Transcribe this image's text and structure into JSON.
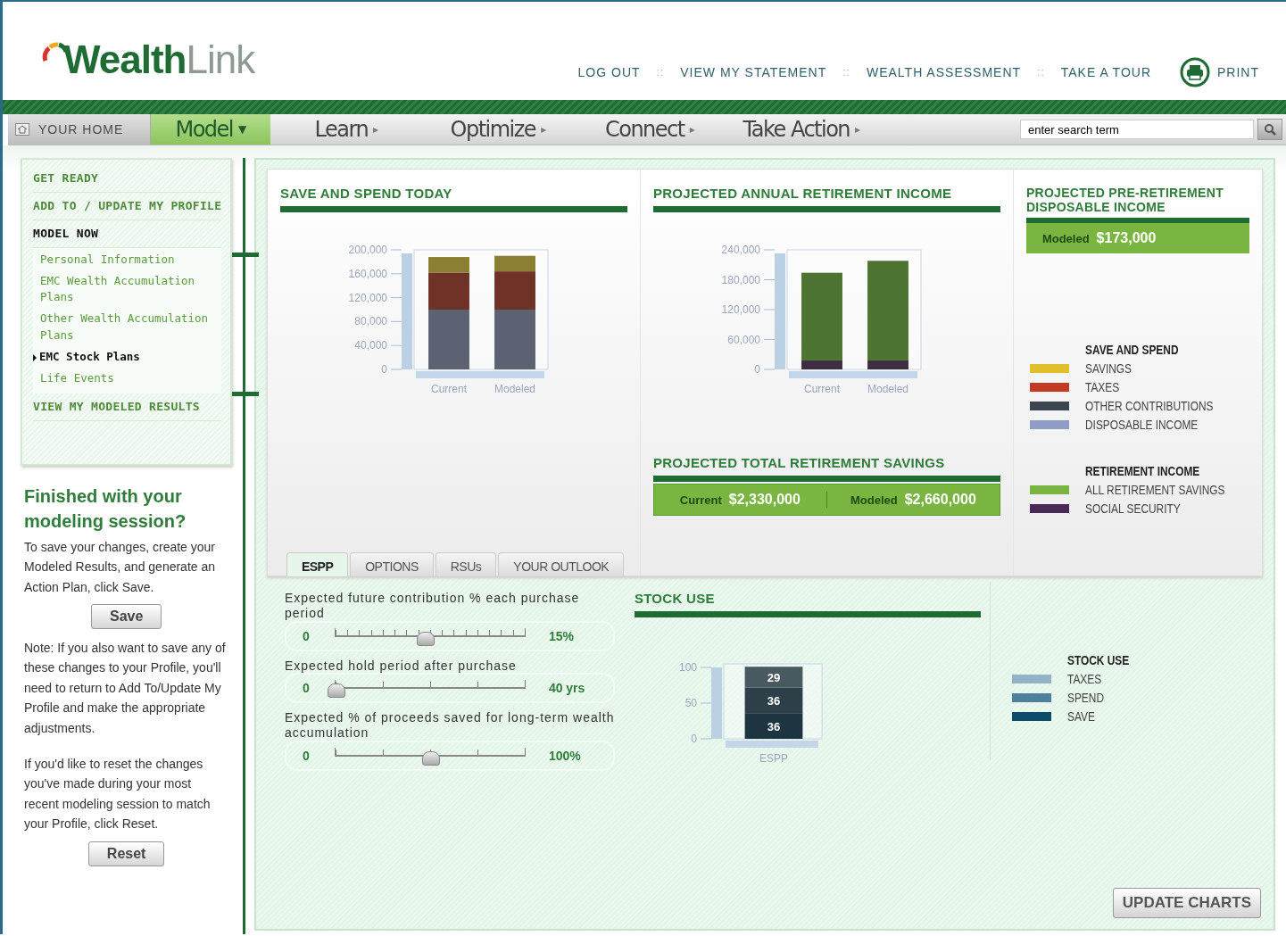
{
  "header": {
    "logo_primary": "Wealth",
    "logo_secondary": "Link",
    "separator": "::",
    "links": [
      "LOG OUT",
      "VIEW MY STATEMENT",
      "WEALTH ASSESSMENT",
      "TAKE A TOUR"
    ],
    "print": "PRINT"
  },
  "nav": {
    "home": "YOUR HOME",
    "items": [
      {
        "label": "Model",
        "arrow": "▼",
        "selected": true
      },
      {
        "label": "Learn",
        "arrow": "▸",
        "selected": false
      },
      {
        "label": "Optimize",
        "arrow": "▸",
        "selected": false
      },
      {
        "label": "Connect",
        "arrow": "▸",
        "selected": false
      },
      {
        "label": "Take Action",
        "arrow": "▸",
        "selected": false
      }
    ],
    "search": {
      "value": "enter search term"
    }
  },
  "sidebar": {
    "items": [
      {
        "label": "GET READY",
        "selected": false
      },
      {
        "label": "ADD TO / UPDATE MY PROFILE",
        "selected": false
      },
      {
        "label": "MODEL NOW",
        "selected": true,
        "children": [
          {
            "label": "Personal Information",
            "selected": false
          },
          {
            "label": "EMC Wealth Accumulation Plans",
            "selected": false
          },
          {
            "label": "Other Wealth Accumulation Plans",
            "selected": false
          },
          {
            "label": "EMC Stock Plans",
            "selected": true
          },
          {
            "label": "Life Events",
            "selected": false
          }
        ]
      },
      {
        "label": "VIEW MY MODELED RESULTS",
        "selected": false
      }
    ]
  },
  "session": {
    "title": "Finished with your modeling session?",
    "save_text": "To save your changes, create your Modeled Results, and generate an Action Plan, click Save.",
    "save_button": "Save",
    "note": "Note: If you also want to save any of these changes to your Profile, you'll need to return to Add To/Update My Profile and make the appropriate adjustments.",
    "reset_text": "If you'd like to reset the changes you've made during your most recent modeling session to match your Profile, click Reset.",
    "reset_button": "Reset"
  },
  "summary": {
    "save_spend": {
      "title": "SAVE AND SPEND TODAY",
      "chart_data": {
        "type": "bar",
        "stacked": true,
        "categories": [
          "Current",
          "Modeled"
        ],
        "series": [
          {
            "color": "#5c6272",
            "values": [
              100000,
              100000
            ]
          },
          {
            "color": "#6e3326",
            "values": [
              62000,
              64000
            ]
          },
          {
            "color": "#8b7f34",
            "values": [
              26000,
              26000
            ]
          }
        ],
        "ylim": [
          0,
          200000
        ],
        "yticks": [
          {
            "value": 0,
            "label": "0"
          },
          {
            "value": 40000,
            "label": "40,000"
          },
          {
            "value": 80000,
            "label": "80,000"
          },
          {
            "value": 120000,
            "label": "120,000"
          },
          {
            "value": 160000,
            "label": "160,000"
          },
          {
            "value": 200000,
            "label": "200,000"
          }
        ]
      }
    },
    "annual": {
      "title": "PROJECTED ANNUAL RETIREMENT INCOME",
      "chart_data": {
        "type": "bar",
        "stacked": true,
        "categories": [
          "Current",
          "Modeled"
        ],
        "series": [
          {
            "color": "#3e2e42",
            "values": [
              18000,
              18000
            ]
          },
          {
            "color": "#4e7433",
            "values": [
              176000,
              200000
            ]
          }
        ],
        "ylim": [
          0,
          240000
        ],
        "yticks": [
          {
            "value": 0,
            "label": "0"
          },
          {
            "value": 60000,
            "label": "60,000"
          },
          {
            "value": 120000,
            "label": "120,000"
          },
          {
            "value": 180000,
            "label": "180,000"
          },
          {
            "value": 240000,
            "label": "240,000"
          }
        ]
      }
    },
    "total_savings": {
      "title": "PROJECTED TOTAL RETIREMENT SAVINGS",
      "items": [
        {
          "label": "Current",
          "value": "$2,330,000"
        },
        {
          "label": "Modeled",
          "value": "$2,660,000"
        }
      ]
    },
    "pre_retirement": {
      "title": "PROJECTED PRE-RETIREMENT DISPOSABLE INCOME",
      "label": "Modeled",
      "value": "$173,000"
    },
    "legends": [
      {
        "title": "SAVE AND SPEND",
        "items": [
          {
            "label": "SAVINGS",
            "color": "#e2c02c"
          },
          {
            "label": "TAXES",
            "color": "#c23a22"
          },
          {
            "label": "OTHER CONTRIBUTIONS",
            "color": "#3a4550"
          },
          {
            "label": "DISPOSABLE INCOME",
            "color": "#8f9dc6"
          }
        ]
      },
      {
        "title": "RETIREMENT INCOME",
        "items": [
          {
            "label": "ALL RETIREMENT SAVINGS",
            "color": "#79b540"
          },
          {
            "label": "SOCIAL SECURITY",
            "color": "#4a2a58"
          }
        ]
      }
    ]
  },
  "stock_tabs": [
    {
      "label": "ESPP",
      "selected": true
    },
    {
      "label": "OPTIONS",
      "selected": false
    },
    {
      "label": "RSUs",
      "selected": false
    },
    {
      "label": "YOUR OUTLOOK",
      "selected": false
    }
  ],
  "sliders": [
    {
      "label": "Expected future contribution % each purchase period",
      "kind": "fine",
      "min": "0",
      "max": "15%",
      "level": 0.47
    },
    {
      "label": "Expected hold period after purchase",
      "kind": "coarse",
      "min": "0",
      "max": "40 yrs",
      "level": 0
    },
    {
      "label": "Expected % of proceeds saved for long-term wealth accumulation",
      "kind": "coarse",
      "min": "0",
      "max": "100%",
      "level": 0.5
    }
  ],
  "stock_use": {
    "title": "STOCK USE",
    "chart_data": {
      "type": "bar",
      "stacked": true,
      "categories": [
        "ESPP"
      ],
      "series": [
        {
          "color": "#1d3540",
          "values": [
            36
          ]
        },
        {
          "color": "#2d3f48",
          "values": [
            36
          ]
        },
        {
          "color": "#485960",
          "values": [
            29
          ]
        }
      ],
      "ylim": [
        0,
        105
      ],
      "yticks": [
        0,
        50,
        100
      ],
      "data_labels": true
    },
    "legend": {
      "title": "STOCK USE",
      "items": [
        {
          "label": "TAXES",
          "color": "#93b2c6"
        },
        {
          "label": "SPEND",
          "color": "#4f809c"
        },
        {
          "label": "SAVE",
          "color": "#0f4b6a"
        }
      ]
    }
  },
  "update_button": "UPDATE CHARTS"
}
